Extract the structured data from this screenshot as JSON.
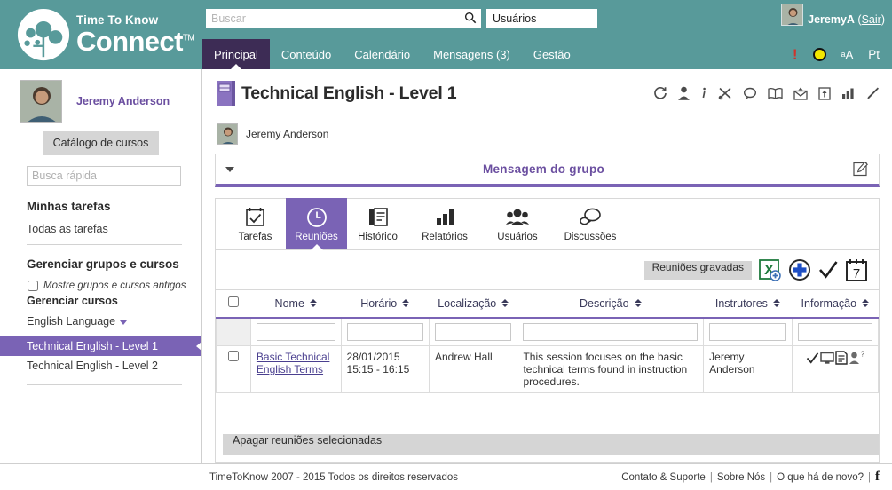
{
  "brand": {
    "line1": "Time To Know",
    "line2": "Connect",
    "tm": "TM"
  },
  "search": {
    "placeholder": "Buscar",
    "value": "",
    "scope": "Usuários",
    "icon": "search-icon"
  },
  "account": {
    "name": "JeremyA",
    "logout_open": " (",
    "logout": "Sair",
    "logout_close": ")"
  },
  "nav": {
    "tabs": [
      {
        "label": "Principal",
        "active": true
      },
      {
        "label": "Conteúdo",
        "active": false
      },
      {
        "label": "Calendário",
        "active": false
      },
      {
        "label": "Mensagens (3)",
        "active": false
      },
      {
        "label": "Gestão",
        "active": false
      }
    ],
    "icons": [
      {
        "name": "alert-icon",
        "glyph": "!",
        "color": "#d0342c"
      },
      {
        "name": "status-dot-icon",
        "glyph": "",
        "color": "#f3e600"
      },
      {
        "name": "text-size-icon",
        "glyph": "aA",
        "color": "#ffffff"
      },
      {
        "name": "language-icon",
        "glyph": "Pt",
        "color": "#ffffff"
      }
    ]
  },
  "sidebar": {
    "user_name": "Jeremy Anderson",
    "catalog_button": "Catálogo de cursos",
    "quick_search_placeholder": "Busca rápida",
    "quick_search_value": "",
    "my_tasks_heading": "Minhas tarefas",
    "all_tasks_link": "Todas as tarefas",
    "manage_heading": "Gerenciar grupos e cursos",
    "show_old_label": "Mostre grupos e cursos antigos",
    "show_old_checked": false,
    "manage_courses_heading": "Gerenciar cursos",
    "group_label": "English Language",
    "courses": [
      {
        "label": "Technical English - Level 1",
        "selected": true
      },
      {
        "label": "Technical English - Level 2",
        "selected": false
      }
    ]
  },
  "page": {
    "title": "Technical English - Level 1",
    "icon": "course-book-icon",
    "tools": [
      {
        "name": "refresh-icon",
        "title": "Atualizar"
      },
      {
        "name": "user-icon",
        "title": "Usuário"
      },
      {
        "name": "info-icon",
        "title": "Informação"
      },
      {
        "name": "tools-icon",
        "title": "Ferramentas"
      },
      {
        "name": "chat-icon",
        "title": "Discussão"
      },
      {
        "name": "book-icon",
        "title": "Livro"
      },
      {
        "name": "mail-send-icon",
        "title": "Enviar email"
      },
      {
        "name": "export-icon",
        "title": "Exportar"
      },
      {
        "name": "chart-icon",
        "title": "Relatório"
      },
      {
        "name": "edit-pencil-icon",
        "title": "Editar"
      }
    ],
    "owner": "Jeremy Anderson",
    "group_message": {
      "title": "Mensagem do grupo",
      "collapse_icon": "chevron-down-icon",
      "edit_icon": "edit-note-icon"
    }
  },
  "panel": {
    "tabs": [
      {
        "label": "Tarefas",
        "icon": "calendar-check-icon",
        "active": false
      },
      {
        "label": "Reuniões",
        "icon": "clock-icon",
        "active": true
      },
      {
        "label": "Histórico",
        "icon": "document-lines-icon",
        "active": false
      },
      {
        "label": "Relatórios",
        "icon": "bar-chart-icon",
        "active": false
      },
      {
        "label": "Usuários",
        "icon": "users-icon",
        "active": false
      },
      {
        "label": "Discussões",
        "icon": "chat-bubbles-icon",
        "active": false
      }
    ],
    "actions": {
      "recorded_button": "Reuniões gravadas",
      "icons": [
        {
          "name": "excel-add-icon"
        },
        {
          "name": "add-circle-icon"
        },
        {
          "name": "check-icon"
        },
        {
          "name": "calendar-7-icon",
          "glyph": "7"
        }
      ]
    },
    "table": {
      "columns": [
        {
          "label": "",
          "key": "select",
          "sortable": false
        },
        {
          "label": "Nome",
          "key": "nome",
          "sortable": true
        },
        {
          "label": "Horário",
          "key": "horario",
          "sortable": true
        },
        {
          "label": "Localização",
          "key": "localizacao",
          "sortable": true
        },
        {
          "label": "Descrição",
          "key": "descricao",
          "sortable": true
        },
        {
          "label": "Instrutores",
          "key": "instrutores",
          "sortable": true
        },
        {
          "label": "Informação",
          "key": "informacao",
          "sortable": true
        }
      ],
      "filters": {
        "nome": "",
        "horario": "",
        "localizacao": "",
        "descricao": "",
        "instrutores": "",
        "informacao": ""
      },
      "rows": [
        {
          "selected": false,
          "nome": "Basic Technical English Terms",
          "horario": "28/01/2015 15:15 - 16:15",
          "localizacao": "Andrew Hall",
          "descricao": "This session focuses on the basic technical terms found in instruction procedures.",
          "instrutores": "Jeremy Anderson",
          "info_icons": [
            "check-icon",
            "monitor-icon",
            "document-icon",
            "person-question-icon"
          ]
        }
      ]
    },
    "delete_button": "Apagar reuniões selecionadas"
  },
  "footer": {
    "copyright": "TimeToKnow 2007 - 2015 Todos os direitos reservados",
    "links": [
      "Contato & Suporte",
      "Sobre Nós",
      "O que há de novo?"
    ],
    "separator": "|",
    "facebook_icon": "f"
  },
  "colors": {
    "teal": "#589a9a",
    "purple": "#7a63b5",
    "dark_purple": "#3d2c55",
    "link_purple": "#6b4fa0",
    "alert_red": "#d0342c",
    "status_yellow": "#f3e600"
  }
}
